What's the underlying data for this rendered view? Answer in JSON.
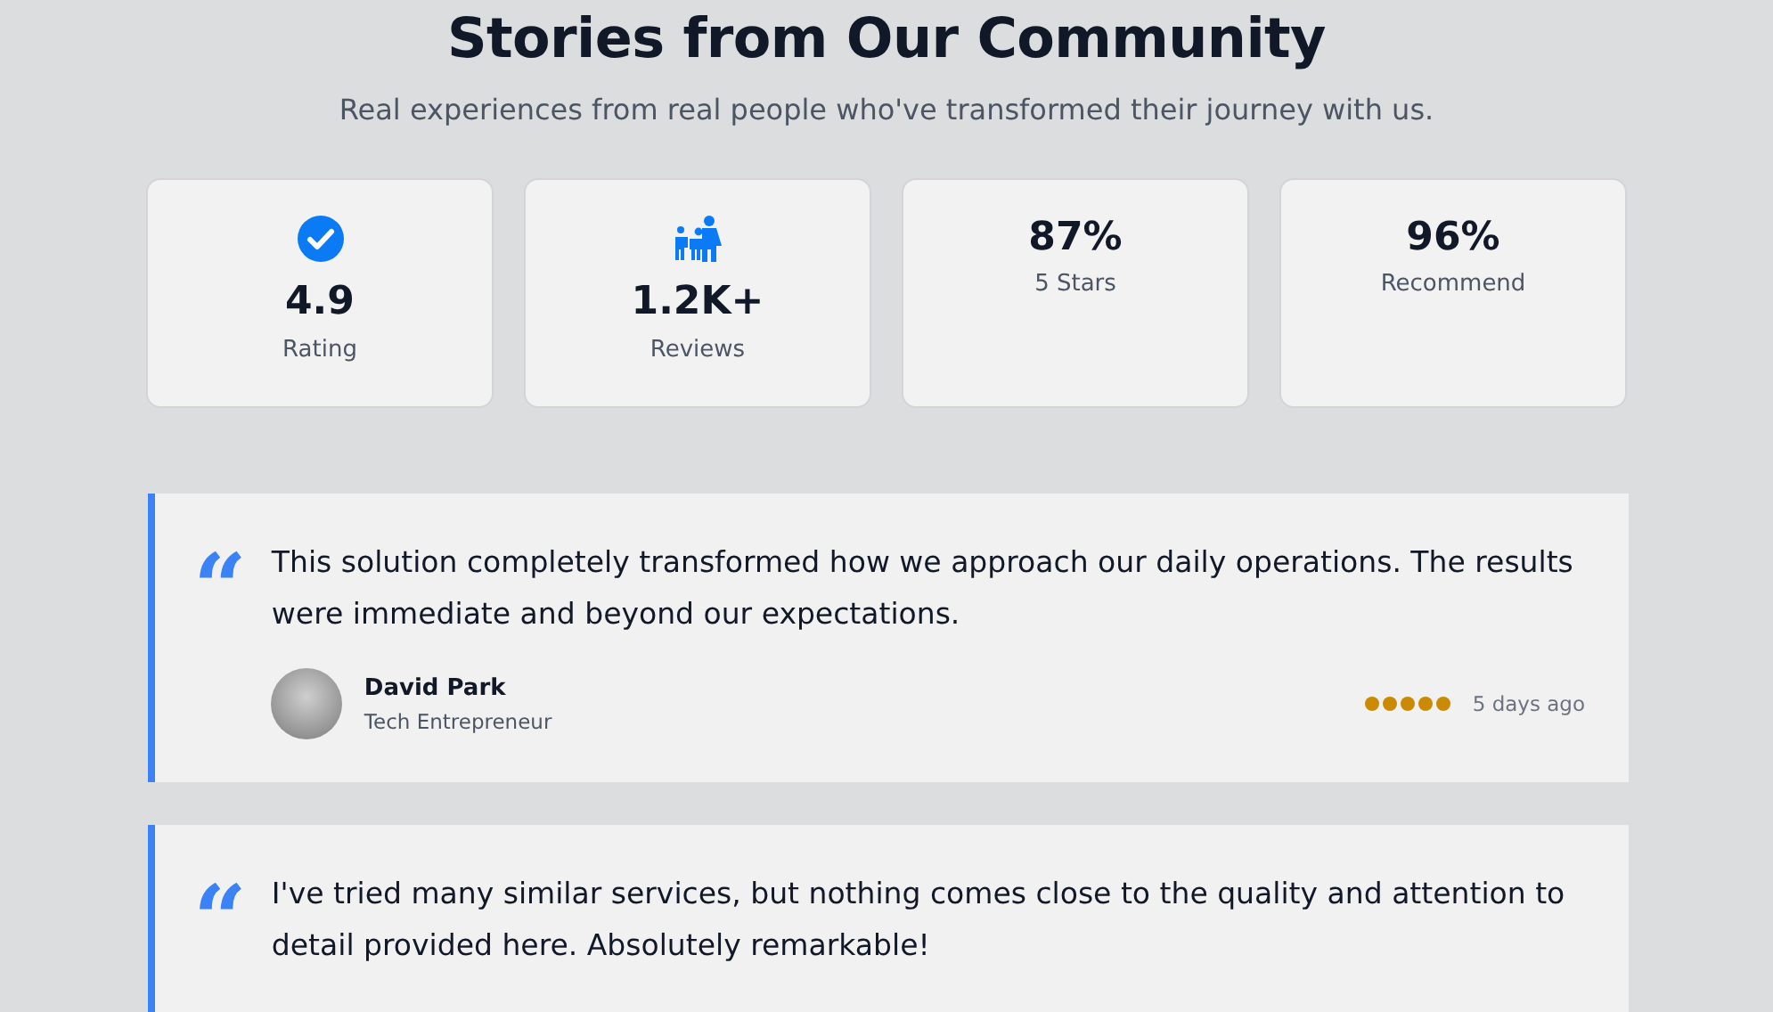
{
  "header": {
    "title": "Stories from Our Community",
    "subtitle": "Real experiences from real people who've transformed their journey with us."
  },
  "stats": [
    {
      "kind": "check",
      "value": "4.9",
      "label": "Rating"
    },
    {
      "kind": "people",
      "value": "1.2K+",
      "label": "Reviews"
    },
    {
      "kind": "plain",
      "value": "87%",
      "label": "5 Stars"
    },
    {
      "kind": "plain",
      "value": "96%",
      "label": "Recommend"
    }
  ],
  "testimonials": [
    {
      "quote_mark": "“",
      "text": "This solution completely transformed how we approach our daily operations. The results were immediate and beyond our expectations.",
      "name": "David Park",
      "role": "Tech Entrepreneur",
      "stars": 5,
      "time": "5 days ago"
    },
    {
      "quote_mark": "“",
      "text": "I've tried many similar services, but nothing comes close to the quality and attention to detail provided here. Absolutely remarkable!"
    }
  ]
}
